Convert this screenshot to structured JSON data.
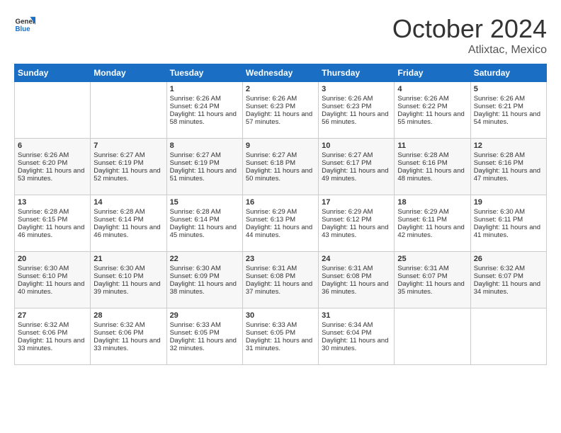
{
  "header": {
    "logo_line1": "General",
    "logo_line2": "Blue",
    "month": "October 2024",
    "location": "Atlixtac, Mexico"
  },
  "days_of_week": [
    "Sunday",
    "Monday",
    "Tuesday",
    "Wednesday",
    "Thursday",
    "Friday",
    "Saturday"
  ],
  "weeks": [
    [
      {
        "day": "",
        "empty": true
      },
      {
        "day": "",
        "empty": true
      },
      {
        "day": "1",
        "sunrise": "Sunrise: 6:26 AM",
        "sunset": "Sunset: 6:24 PM",
        "daylight": "Daylight: 11 hours and 58 minutes."
      },
      {
        "day": "2",
        "sunrise": "Sunrise: 6:26 AM",
        "sunset": "Sunset: 6:23 PM",
        "daylight": "Daylight: 11 hours and 57 minutes."
      },
      {
        "day": "3",
        "sunrise": "Sunrise: 6:26 AM",
        "sunset": "Sunset: 6:23 PM",
        "daylight": "Daylight: 11 hours and 56 minutes."
      },
      {
        "day": "4",
        "sunrise": "Sunrise: 6:26 AM",
        "sunset": "Sunset: 6:22 PM",
        "daylight": "Daylight: 11 hours and 55 minutes."
      },
      {
        "day": "5",
        "sunrise": "Sunrise: 6:26 AM",
        "sunset": "Sunset: 6:21 PM",
        "daylight": "Daylight: 11 hours and 54 minutes."
      }
    ],
    [
      {
        "day": "6",
        "sunrise": "Sunrise: 6:26 AM",
        "sunset": "Sunset: 6:20 PM",
        "daylight": "Daylight: 11 hours and 53 minutes."
      },
      {
        "day": "7",
        "sunrise": "Sunrise: 6:27 AM",
        "sunset": "Sunset: 6:19 PM",
        "daylight": "Daylight: 11 hours and 52 minutes."
      },
      {
        "day": "8",
        "sunrise": "Sunrise: 6:27 AM",
        "sunset": "Sunset: 6:19 PM",
        "daylight": "Daylight: 11 hours and 51 minutes."
      },
      {
        "day": "9",
        "sunrise": "Sunrise: 6:27 AM",
        "sunset": "Sunset: 6:18 PM",
        "daylight": "Daylight: 11 hours and 50 minutes."
      },
      {
        "day": "10",
        "sunrise": "Sunrise: 6:27 AM",
        "sunset": "Sunset: 6:17 PM",
        "daylight": "Daylight: 11 hours and 49 minutes."
      },
      {
        "day": "11",
        "sunrise": "Sunrise: 6:28 AM",
        "sunset": "Sunset: 6:16 PM",
        "daylight": "Daylight: 11 hours and 48 minutes."
      },
      {
        "day": "12",
        "sunrise": "Sunrise: 6:28 AM",
        "sunset": "Sunset: 6:16 PM",
        "daylight": "Daylight: 11 hours and 47 minutes."
      }
    ],
    [
      {
        "day": "13",
        "sunrise": "Sunrise: 6:28 AM",
        "sunset": "Sunset: 6:15 PM",
        "daylight": "Daylight: 11 hours and 46 minutes."
      },
      {
        "day": "14",
        "sunrise": "Sunrise: 6:28 AM",
        "sunset": "Sunset: 6:14 PM",
        "daylight": "Daylight: 11 hours and 46 minutes."
      },
      {
        "day": "15",
        "sunrise": "Sunrise: 6:28 AM",
        "sunset": "Sunset: 6:14 PM",
        "daylight": "Daylight: 11 hours and 45 minutes."
      },
      {
        "day": "16",
        "sunrise": "Sunrise: 6:29 AM",
        "sunset": "Sunset: 6:13 PM",
        "daylight": "Daylight: 11 hours and 44 minutes."
      },
      {
        "day": "17",
        "sunrise": "Sunrise: 6:29 AM",
        "sunset": "Sunset: 6:12 PM",
        "daylight": "Daylight: 11 hours and 43 minutes."
      },
      {
        "day": "18",
        "sunrise": "Sunrise: 6:29 AM",
        "sunset": "Sunset: 6:11 PM",
        "daylight": "Daylight: 11 hours and 42 minutes."
      },
      {
        "day": "19",
        "sunrise": "Sunrise: 6:30 AM",
        "sunset": "Sunset: 6:11 PM",
        "daylight": "Daylight: 11 hours and 41 minutes."
      }
    ],
    [
      {
        "day": "20",
        "sunrise": "Sunrise: 6:30 AM",
        "sunset": "Sunset: 6:10 PM",
        "daylight": "Daylight: 11 hours and 40 minutes."
      },
      {
        "day": "21",
        "sunrise": "Sunrise: 6:30 AM",
        "sunset": "Sunset: 6:10 PM",
        "daylight": "Daylight: 11 hours and 39 minutes."
      },
      {
        "day": "22",
        "sunrise": "Sunrise: 6:30 AM",
        "sunset": "Sunset: 6:09 PM",
        "daylight": "Daylight: 11 hours and 38 minutes."
      },
      {
        "day": "23",
        "sunrise": "Sunrise: 6:31 AM",
        "sunset": "Sunset: 6:08 PM",
        "daylight": "Daylight: 11 hours and 37 minutes."
      },
      {
        "day": "24",
        "sunrise": "Sunrise: 6:31 AM",
        "sunset": "Sunset: 6:08 PM",
        "daylight": "Daylight: 11 hours and 36 minutes."
      },
      {
        "day": "25",
        "sunrise": "Sunrise: 6:31 AM",
        "sunset": "Sunset: 6:07 PM",
        "daylight": "Daylight: 11 hours and 35 minutes."
      },
      {
        "day": "26",
        "sunrise": "Sunrise: 6:32 AM",
        "sunset": "Sunset: 6:07 PM",
        "daylight": "Daylight: 11 hours and 34 minutes."
      }
    ],
    [
      {
        "day": "27",
        "sunrise": "Sunrise: 6:32 AM",
        "sunset": "Sunset: 6:06 PM",
        "daylight": "Daylight: 11 hours and 33 minutes."
      },
      {
        "day": "28",
        "sunrise": "Sunrise: 6:32 AM",
        "sunset": "Sunset: 6:06 PM",
        "daylight": "Daylight: 11 hours and 33 minutes."
      },
      {
        "day": "29",
        "sunrise": "Sunrise: 6:33 AM",
        "sunset": "Sunset: 6:05 PM",
        "daylight": "Daylight: 11 hours and 32 minutes."
      },
      {
        "day": "30",
        "sunrise": "Sunrise: 6:33 AM",
        "sunset": "Sunset: 6:05 PM",
        "daylight": "Daylight: 11 hours and 31 minutes."
      },
      {
        "day": "31",
        "sunrise": "Sunrise: 6:34 AM",
        "sunset": "Sunset: 6:04 PM",
        "daylight": "Daylight: 11 hours and 30 minutes."
      },
      {
        "day": "",
        "empty": true
      },
      {
        "day": "",
        "empty": true
      }
    ]
  ]
}
